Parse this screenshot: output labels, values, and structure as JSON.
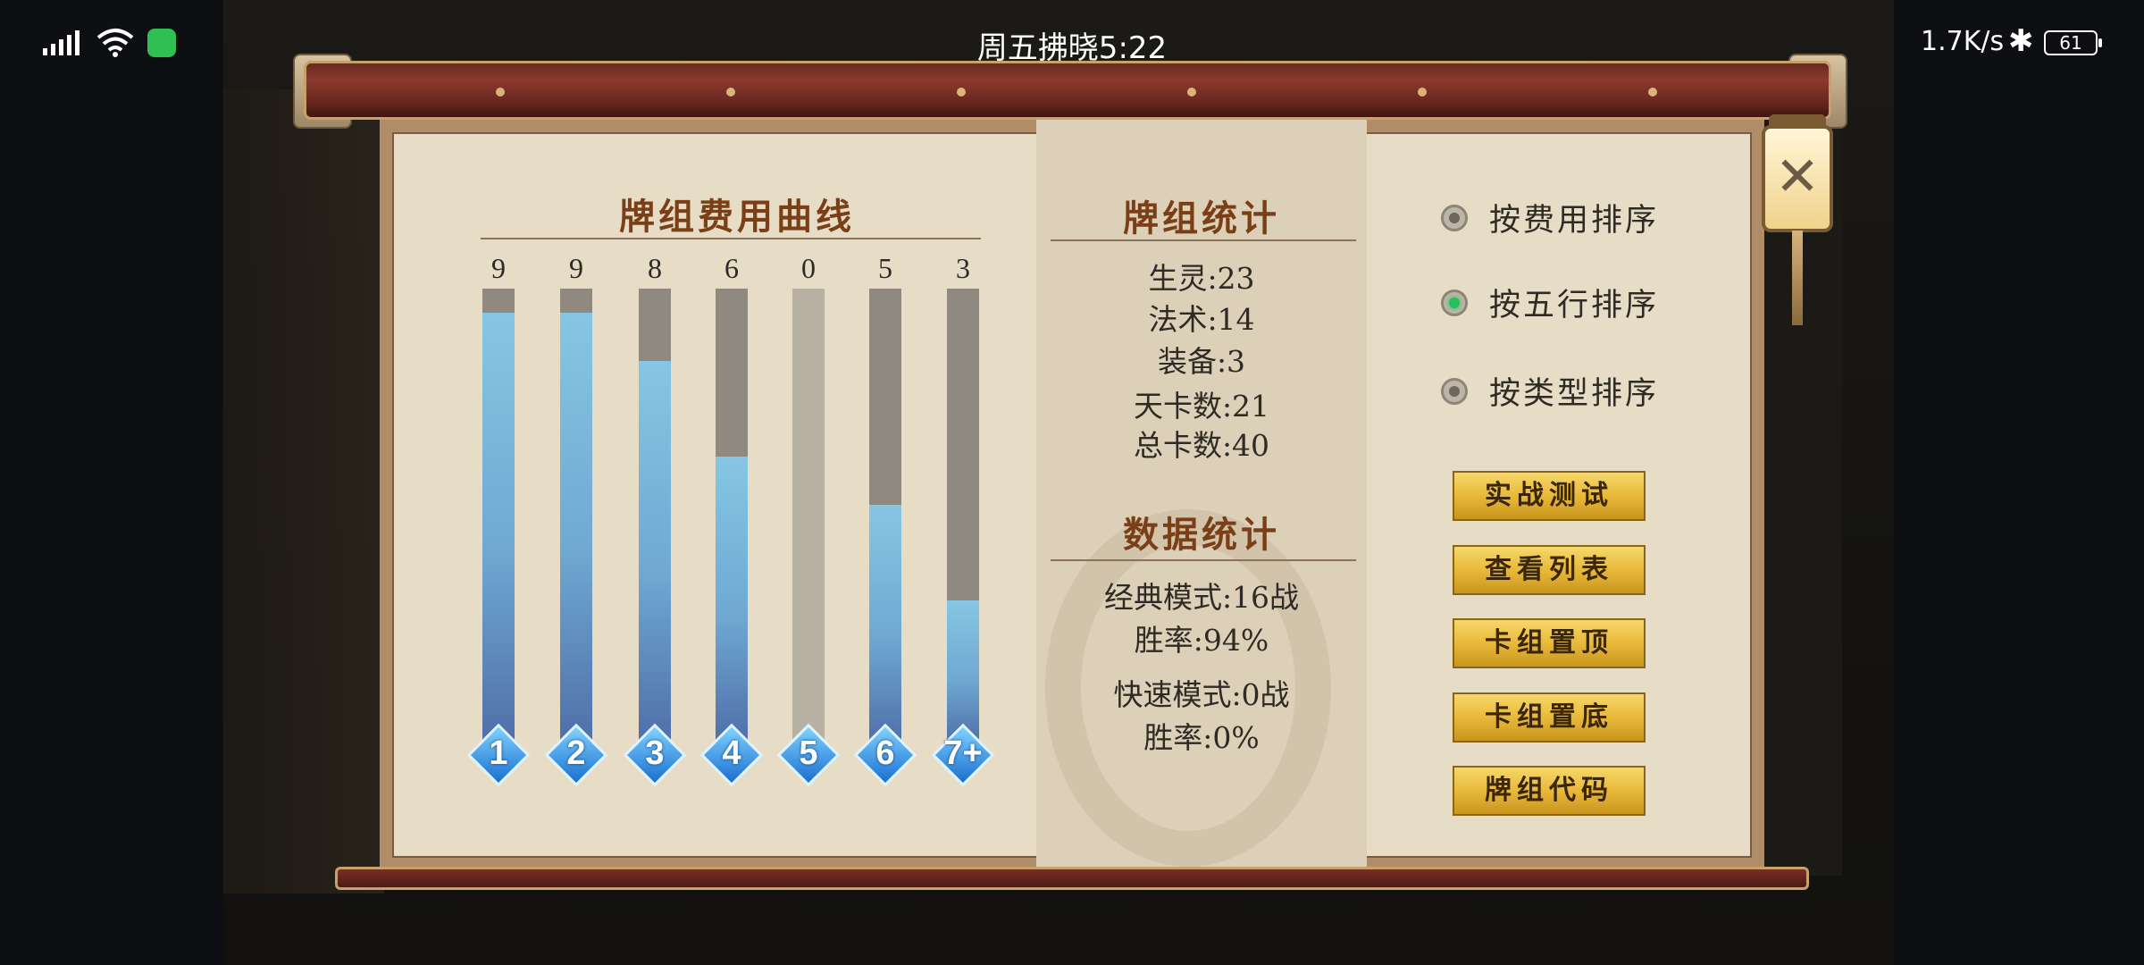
{
  "status_bar": {
    "time": "周五拂晓5:22",
    "net_speed": "1.7K/s",
    "battery": "61"
  },
  "cost_curve": {
    "title": "牌组费用曲线"
  },
  "chart_data": {
    "type": "bar",
    "title": "牌组费用曲线",
    "categories": [
      "1",
      "2",
      "3",
      "4",
      "5",
      "6",
      "7+"
    ],
    "values": [
      9,
      9,
      8,
      6,
      0,
      5,
      3
    ],
    "ylim": [
      0,
      9.5
    ]
  },
  "deck_stats": {
    "title": "牌组统计",
    "lines": [
      "生灵:23",
      "法术:14",
      "装备:3",
      "天卡数:21",
      "总卡数:40"
    ]
  },
  "data_stats": {
    "title": "数据统计",
    "lines": [
      "经典模式:16战",
      "胜率:94%",
      "快速模式:0战",
      "胜率:0%"
    ]
  },
  "sort_options": [
    {
      "label": "按费用排序",
      "selected": false
    },
    {
      "label": "按五行排序",
      "selected": true
    },
    {
      "label": "按类型排序",
      "selected": false
    }
  ],
  "buttons": [
    "实战测试",
    "查看列表",
    "卡组置顶",
    "卡组置底",
    "牌组代码"
  ]
}
